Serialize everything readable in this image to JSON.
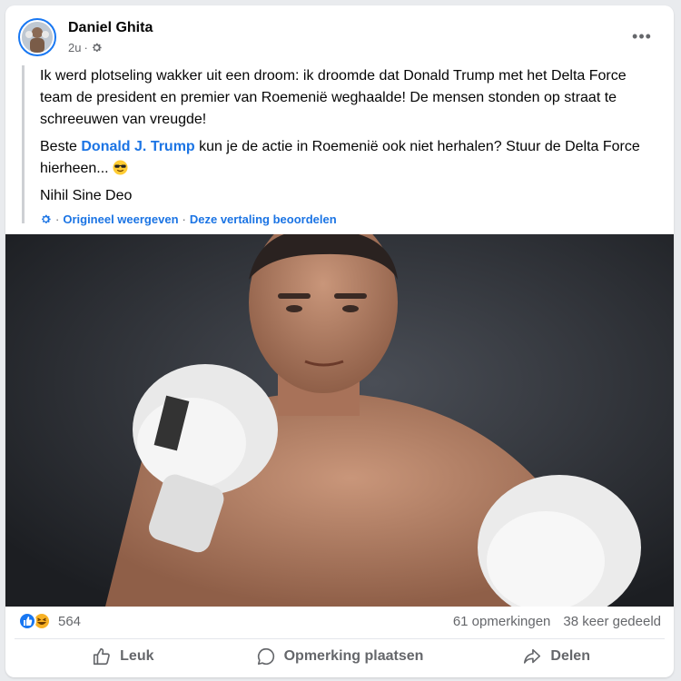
{
  "post": {
    "author": "Daniel Ghita",
    "time": "2u",
    "meta_separator": "·",
    "more_label": "•••",
    "text": {
      "paragraph1": "Ik werd plotseling wakker uit een droom: ik droomde dat Donald Trump met het Delta Force team de president en premier van Roemenië weghaalde! De mensen stonden op straat te schreeuwen van vreugde!",
      "paragraph2_before": "Beste ",
      "paragraph2_mention": "Donald J. Trump",
      "paragraph2_after": " kun je de actie in Roemenië ook niet herhalen? Stuur de Delta Force hierheen... ",
      "paragraph3": "Nihil Sine Deo"
    },
    "translation": {
      "separator": "·",
      "show_original": "Origineel weergeven",
      "rate_translation": "Deze vertaling beoordelen"
    },
    "photo_icon": "boxer-photo",
    "reactions": {
      "icons": [
        "like-icon",
        "haha-icon"
      ],
      "count": "564"
    },
    "comments": "61 opmerkingen",
    "shares": "38 keer gedeeld",
    "actions": {
      "like": "Leuk",
      "comment": "Opmerking plaatsen",
      "share": "Delen"
    }
  },
  "colors": {
    "accent": "#1877f2",
    "link": "#1b74e4",
    "muted": "#65676b",
    "haha": "#f7b125"
  }
}
